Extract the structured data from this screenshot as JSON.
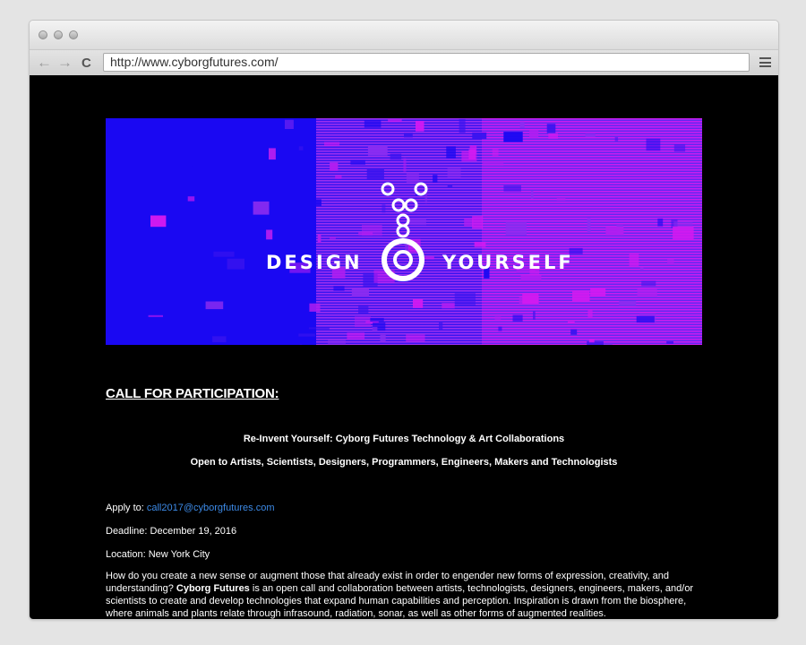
{
  "browser": {
    "url": "http://www.cyborgfutures.com/",
    "back_icon": "←",
    "forward_icon": "→",
    "reload_icon": "C"
  },
  "banner": {
    "word_left": "DESIGN",
    "word_right": "YOURSELF",
    "colors": {
      "blue": "#1a08f2",
      "magenta": "#d21af0",
      "purple": "#8a2cf0"
    }
  },
  "page": {
    "heading": "CALL FOR PARTICIPATION:",
    "subtitle1": "Re-Invent Yourself: Cyborg Futures Technology & Art Collaborations",
    "subtitle2": "Open to Artists, Scientists, Designers, Programmers, Engineers, Makers and Technologists",
    "apply_label": "Apply to: ",
    "apply_email": "call2017@cyborgfutures.com",
    "deadline": "Deadline: December 19, 2016",
    "location": "Location: New York City",
    "para_before": "How do you create a new sense or augment those that already exist in order to engender new forms of expression, creativity, and understanding? ",
    "para_bold": "Cyborg Futures",
    "para_after": " is an open call and collaboration between artists, technologists, designers, engineers, makers, and/or scientists to create and develop technologies that expand human capabilities and perception. Inspiration is drawn from the biosphere, where animals and plants relate through infrasound, radiation, sonar, as well as other forms of augmented realities."
  }
}
